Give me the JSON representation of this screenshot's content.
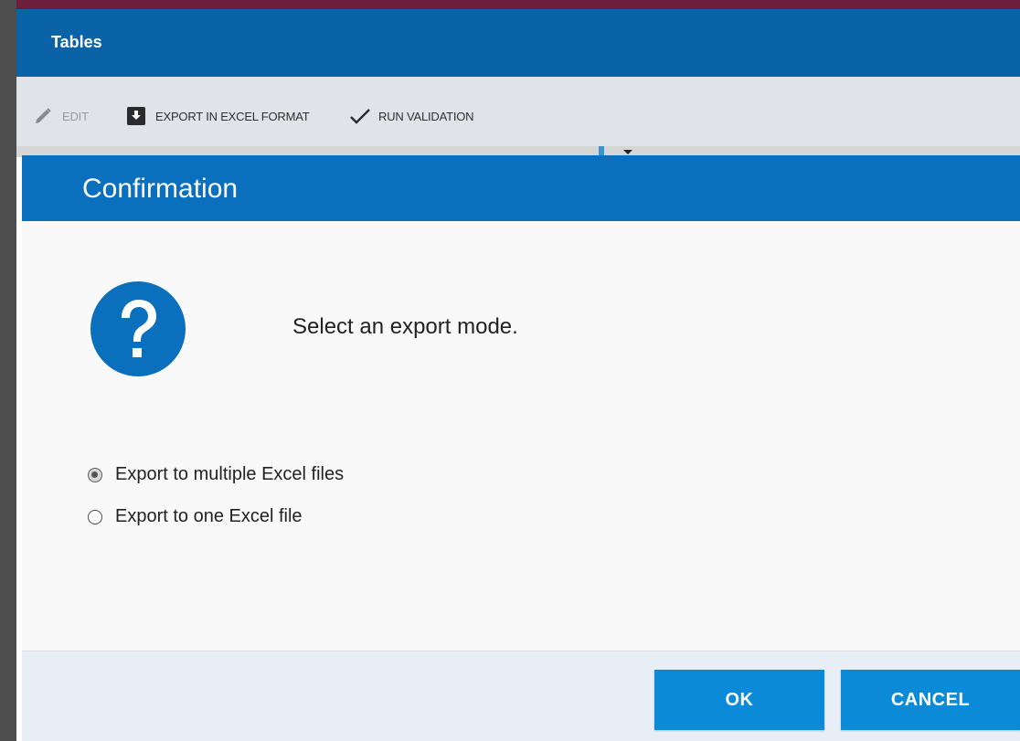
{
  "app": {
    "title": "Tables"
  },
  "toolbar": {
    "edit_label": "EDIT",
    "export_label": "EXPORT IN EXCEL FORMAT",
    "validation_label": "RUN VALIDATION"
  },
  "dialog": {
    "title": "Confirmation",
    "message": "Select an export mode.",
    "options": [
      {
        "label": "Export to multiple Excel files",
        "selected": true
      },
      {
        "label": "Export to one Excel file",
        "selected": false
      }
    ],
    "ok_label": "OK",
    "cancel_label": "CANCEL"
  },
  "icons": {
    "edit": "pencil-icon",
    "export": "download-box-icon",
    "validation": "checkmark-icon",
    "dialog": "question-circle-icon"
  },
  "colors": {
    "app_header": "#0a63a6",
    "dialog_header": "#0a6fbd",
    "button": "#0a8ad7",
    "top_strip": "#6b1f3a"
  }
}
